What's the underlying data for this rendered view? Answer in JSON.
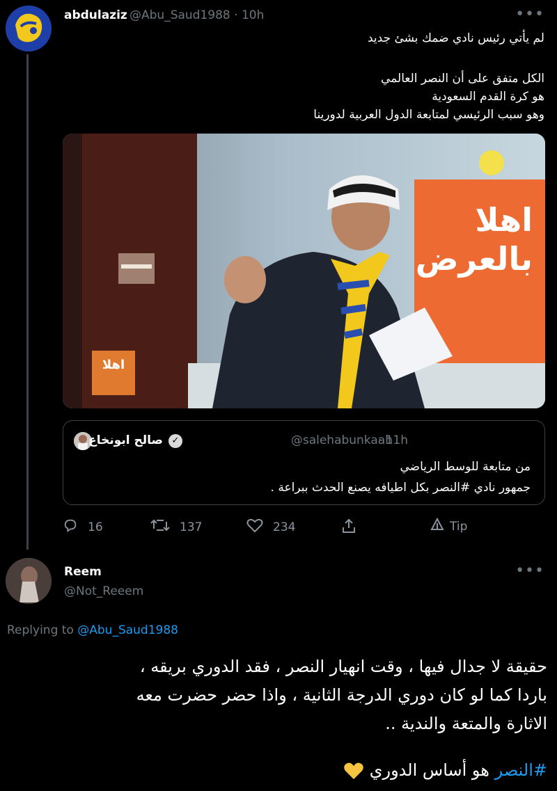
{
  "tweet": {
    "author_name": "abdulaziz",
    "author_handle": "@Abu_Saud1988 · 10h",
    "text_lines": [
      "لم يأتي رئيس نادي ضمك بشئ جديد",
      "الكل متفق على أن النصر العالمي",
      "هو كرة القدم السعودية",
      "وهو سبب الرئيسي لمتابعة الدول العربية لدورينا"
    ],
    "media": {
      "banner_text": "اهلا بالعرض",
      "corner_logo_text": "اهلا"
    },
    "quote": {
      "author_name": "صالح ابونخاع",
      "author_handle": "@salehabunkaah",
      "time": "· 11h",
      "text_lines": [
        "من متابعة للوسط الرياضي",
        "جمهور نادي #النصر بكل اطيافه يصنع الحدث ببراعة ."
      ]
    },
    "actions": {
      "reply_count": "16",
      "retweet_count": "137",
      "like_count": "234",
      "tip_label": "Tip"
    }
  },
  "reply": {
    "author_name": "Reem",
    "author_handle": "@Not_Reeem",
    "replying_prefix": "Replying to",
    "replying_to": "@Abu_Saud1988",
    "text_lines": [
      "حقيقة لا جدال فيها ، وقت انهيار النصر ، فقد الدوري بريقه ،",
      "باردا كما لو كان دوري الدرجة الثانية ، واذا حضر حضرت معه",
      "الاثارة  والمتعة والندية .."
    ],
    "hashtag": "#النصر",
    "closing_text": "هو أساس الدوري"
  },
  "colors": {
    "background": "#000000",
    "link": "#1d9bf0",
    "muted": "#6e767d",
    "heart": "#f5c542"
  }
}
